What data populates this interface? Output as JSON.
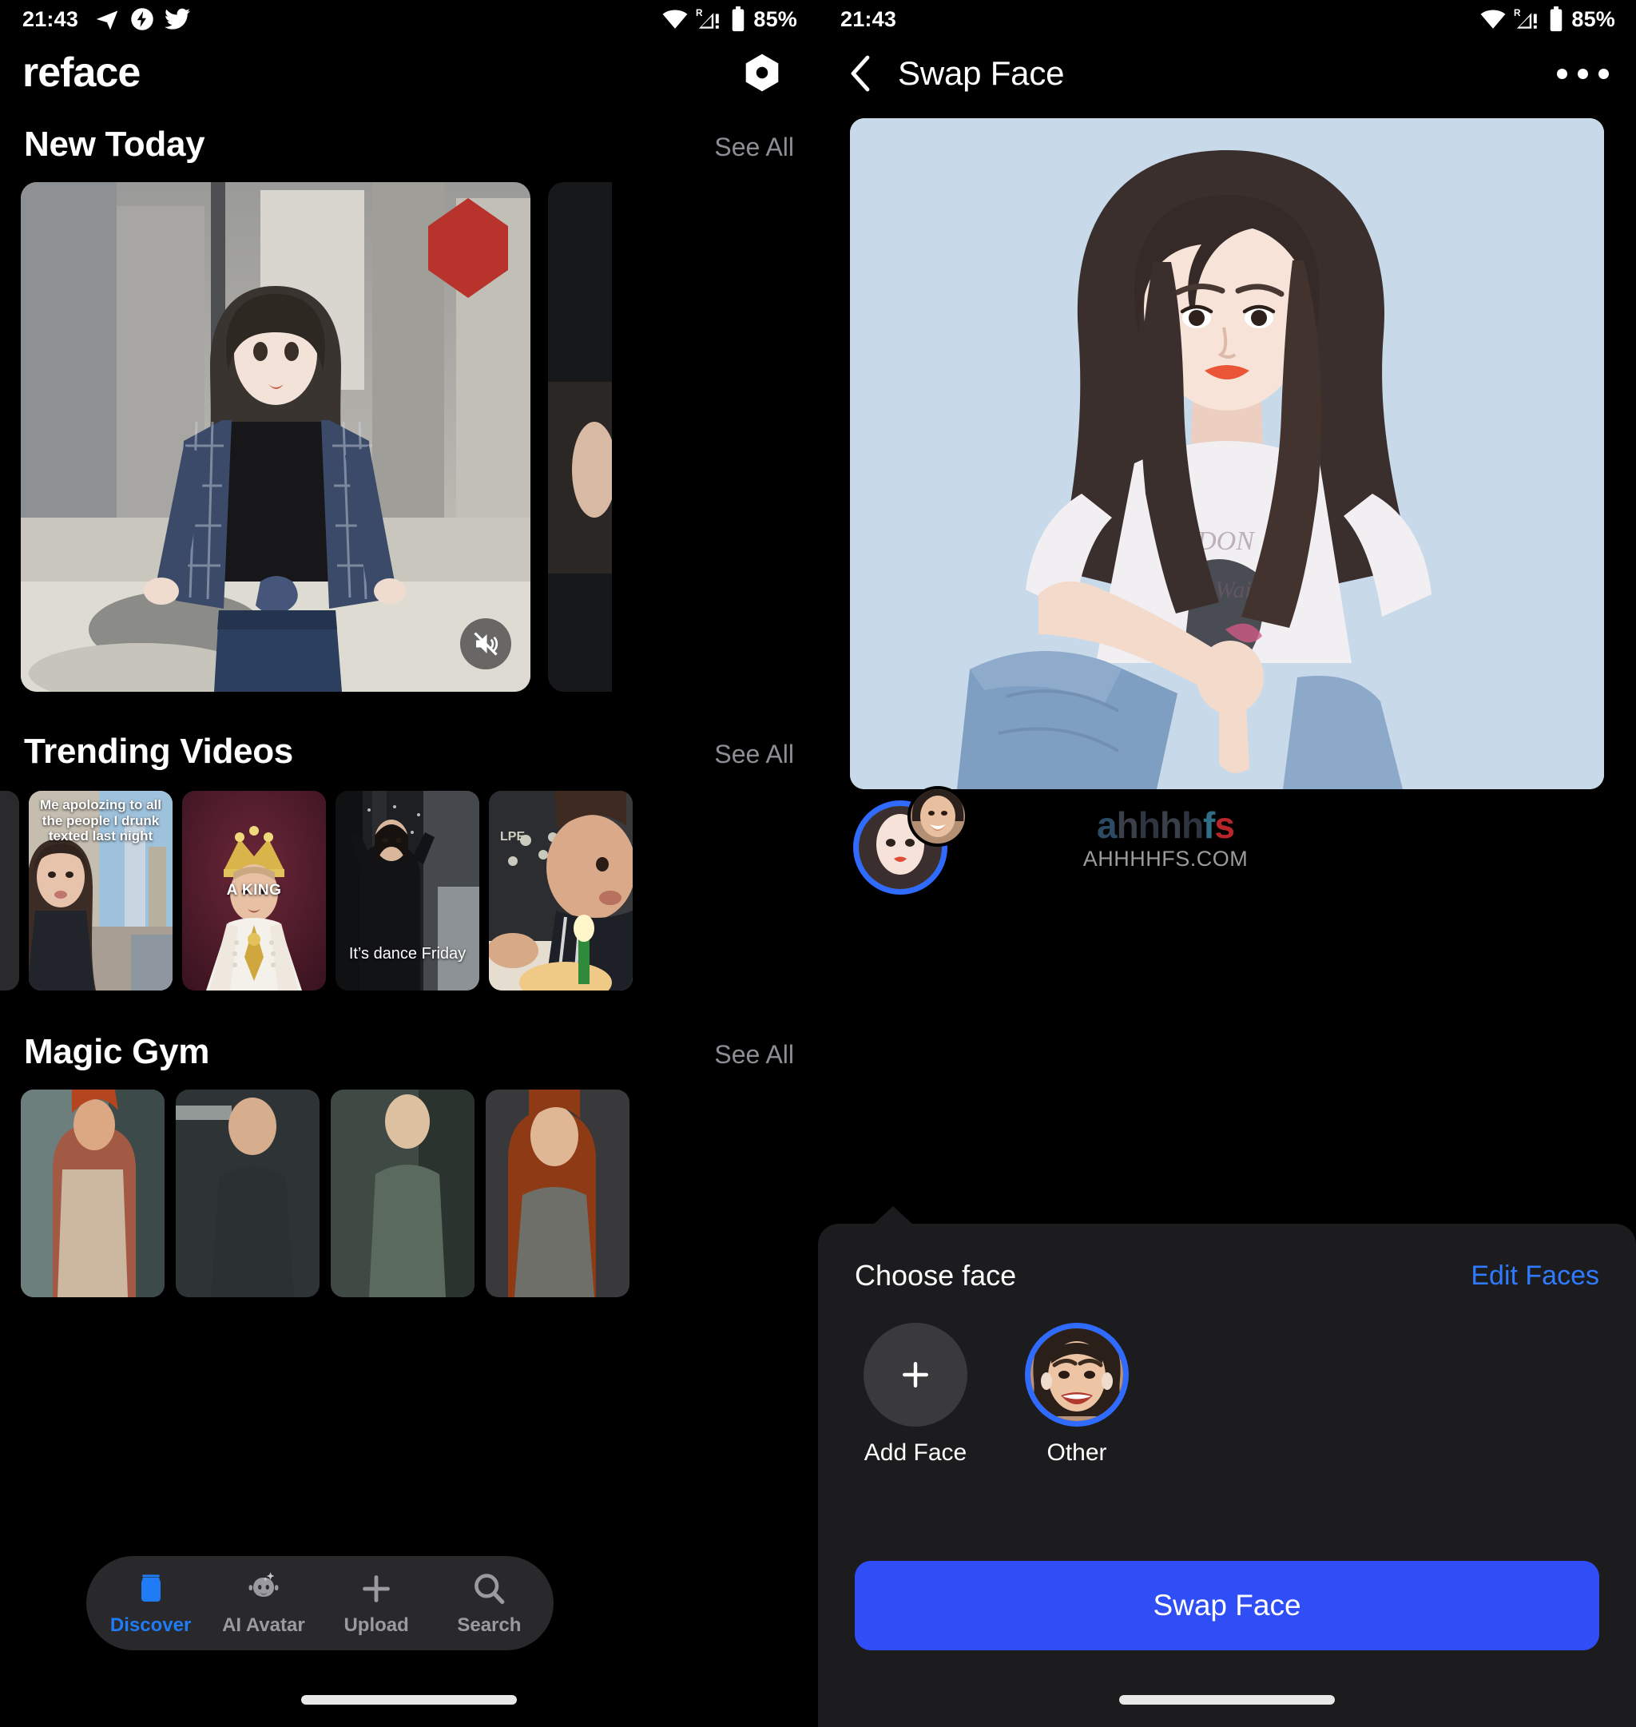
{
  "left": {
    "statusbar": {
      "time": "21:43",
      "battery": "85%",
      "icons": [
        "telegram-icon",
        "bolt-circle-icon",
        "twitter-icon",
        "wifi-icon",
        "signal-roaming-icon",
        "battery-icon"
      ]
    },
    "header": {
      "brand": "reface",
      "action_icon": "hexagon-icon"
    },
    "sections": [
      {
        "title": "New Today",
        "see_all": "See All"
      },
      {
        "title": "Trending Videos",
        "see_all": "See All"
      },
      {
        "title": "Magic Gym",
        "see_all": "See All"
      }
    ],
    "hero": {
      "mute_icon": "speaker-muted-icon"
    },
    "trending": [
      {
        "caption": "Me apolozing to all the people I drunk texted last night",
        "pos": "top"
      },
      {
        "caption": "A KING",
        "pos": "mid"
      },
      {
        "caption": "It’s dance Friday",
        "pos": "low"
      },
      {
        "caption": "",
        "pos": "none"
      }
    ],
    "tabbar": [
      {
        "label": "Discover",
        "icon": "jar-icon",
        "active": true
      },
      {
        "label": "AI Avatar",
        "icon": "avatar-sparkle-icon",
        "active": false
      },
      {
        "label": "Upload",
        "icon": "plus-icon",
        "active": false
      },
      {
        "label": "Search",
        "icon": "search-icon",
        "active": false
      }
    ]
  },
  "right": {
    "statusbar": {
      "time": "21:43",
      "battery": "85%"
    },
    "header": {
      "back_icon": "chevron-left-icon",
      "title": "Swap Face",
      "menu_icon": "more-horizontal-icon"
    },
    "face_chip": {
      "selected_icon": "selected-face-avatar",
      "badge_icon": "source-face-avatar"
    },
    "watermark": {
      "logo": "ahhhhfs",
      "url": "AHHHHFS.COM"
    },
    "sheet": {
      "title": "Choose face",
      "edit_link": "Edit Faces",
      "faces": [
        {
          "label": "Add Face",
          "type": "add",
          "icon": "plus-icon",
          "selected": false
        },
        {
          "label": "Other",
          "type": "face",
          "icon": "face-avatar",
          "selected": true
        }
      ],
      "primary_button": "Swap Face"
    }
  },
  "colors": {
    "accent_blue": "#2f4ef5",
    "link_blue": "#2f7bff",
    "ring_blue": "#2f6bff",
    "sheet_bg": "#1c1c1e",
    "tabbar_bg": "#2c2c2e",
    "muted_text": "#8d8d93",
    "preview_bg": "#c8dae9"
  }
}
